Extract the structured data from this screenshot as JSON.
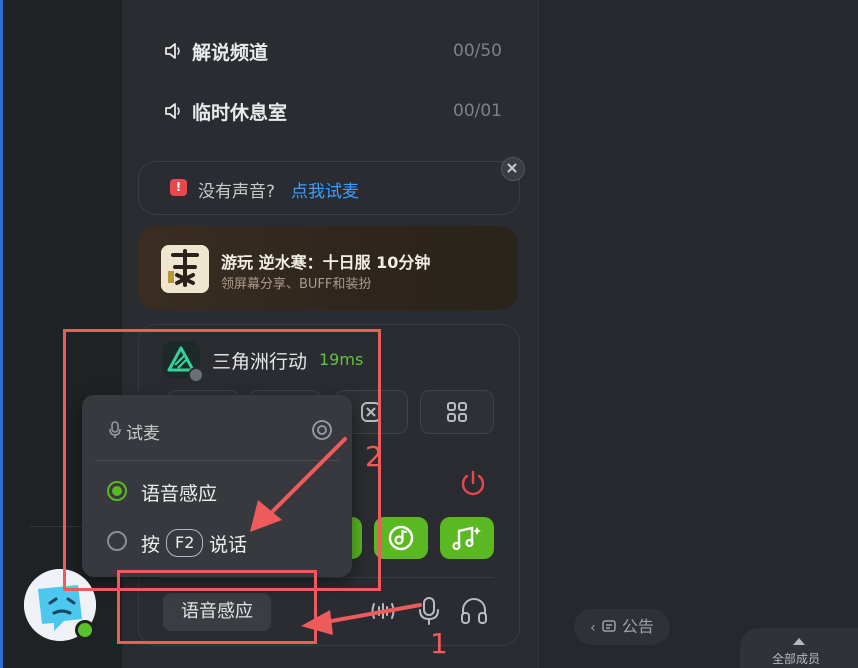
{
  "channels": [
    {
      "name": "解说频道",
      "count": "00/50",
      "icon": "speaker-icon"
    },
    {
      "name": "临时休息室",
      "count": "00/01",
      "icon": "speaker-icon"
    }
  ],
  "no_sound": {
    "prefix": "没有声音?",
    "link": "点我试麦",
    "icon": "alert-icon"
  },
  "game_banner": {
    "title": "游玩 逆水寒：十日服 10分钟",
    "subtitle": "领屏幕分享、BUFF和装扮"
  },
  "game_card": {
    "name": "三角洲行动",
    "ping": "19ms",
    "status": "offline"
  },
  "voice_mode_button": "语音感应",
  "popup": {
    "title": "试麦",
    "options": [
      {
        "label": "语音感应",
        "selected": true
      },
      {
        "label_pre": "按",
        "key": "F2",
        "label_post": "说话",
        "selected": false
      }
    ]
  },
  "right_panel": {
    "announce": "公告",
    "members": "全部成员"
  },
  "annotations": {
    "one": "1",
    "two": "2"
  },
  "colors": {
    "accent_green": "#5ab823",
    "annotation_red": "#ef5a5a",
    "link_blue": "#3f9cff"
  }
}
